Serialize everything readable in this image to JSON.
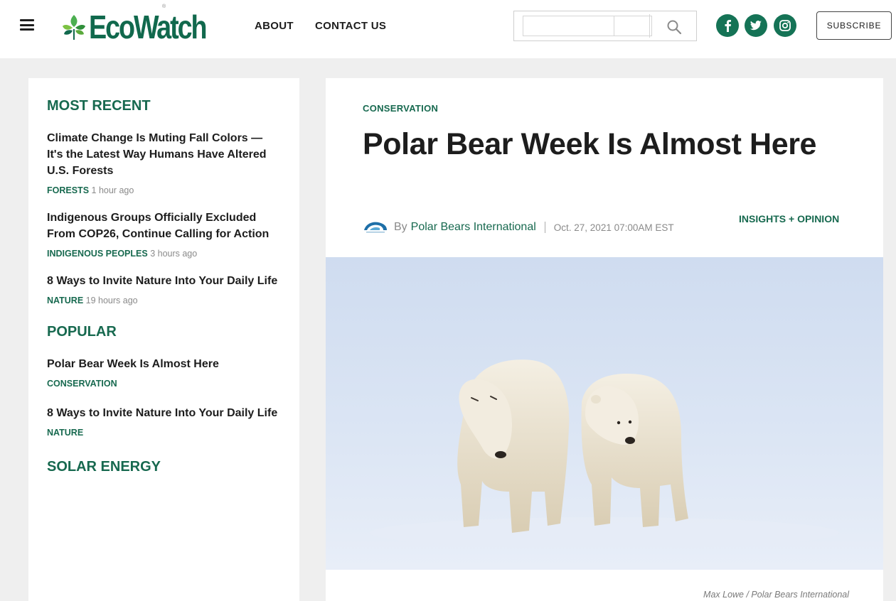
{
  "header": {
    "logo_text": "EcoWatch",
    "logo_reg": "®",
    "nav": [
      "ABOUT",
      "CONTACT US"
    ],
    "search_placeholder": "",
    "social": [
      "facebook",
      "twitter",
      "instagram"
    ],
    "subscribe_label": "SUBSCRIBE"
  },
  "sidebar": {
    "most_recent_title": "MOST RECENT",
    "most_recent": [
      {
        "title": "Climate Change Is Muting Fall Colors — It's the Latest Way Humans Have Altered U.S. Forests",
        "tag": "FORESTS",
        "time": "1 hour ago"
      },
      {
        "title": "Indigenous Groups Officially Excluded From COP26, Continue Calling for Action",
        "tag": "INDIGENOUS PEOPLES",
        "time": "3 hours ago"
      },
      {
        "title": "8 Ways to Invite Nature Into Your Daily Life",
        "tag": "NATURE",
        "time": "19 hours ago"
      }
    ],
    "popular_title": "POPULAR",
    "popular": [
      {
        "title": "Polar Bear Week Is Almost Here",
        "tag": "CONSERVATION"
      },
      {
        "title": "8 Ways to Invite Nature Into Your Daily Life",
        "tag": "NATURE"
      }
    ],
    "solar_title": "SOLAR ENERGY"
  },
  "article": {
    "category": "CONSERVATION",
    "headline": "Polar Bear Week Is Almost Here",
    "by": "By",
    "author": "Polar Bears International",
    "date": "Oct. 27, 2021 07:00AM EST",
    "section": "INSIGHTS + OPINION",
    "caption": "Max Lowe / Polar Bears International"
  },
  "colors": {
    "brand_green": "#17694f",
    "background": "#efefef"
  }
}
